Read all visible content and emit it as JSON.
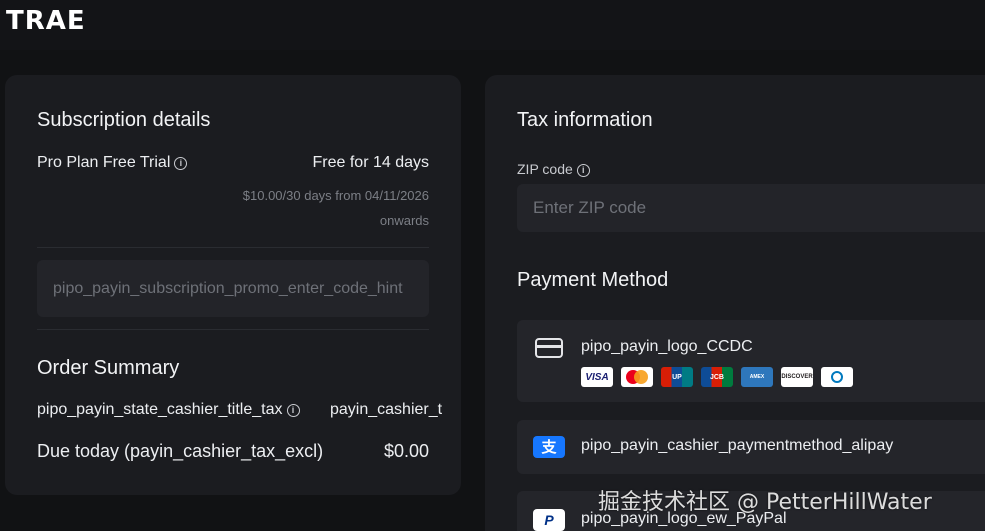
{
  "header": {
    "logo_text": "TRAE"
  },
  "subscription": {
    "title": "Subscription details",
    "plan_name": "Pro Plan Free Trial",
    "plan_price": "Free for 14 days",
    "renewal_line1": "$10.00/30 days from 04/11/2026",
    "renewal_line2": "onwards",
    "promo_placeholder": "pipo_payin_subscription_promo_enter_code_hint"
  },
  "order_summary": {
    "title": "Order Summary",
    "tax_row_label": "pipo_payin_state_cashier_title_tax",
    "tax_row_value": "payin_cashier_t",
    "due_label": "Due today (payin_cashier_tax_excl)",
    "due_value": "$0.00"
  },
  "tax_info": {
    "title": "Tax information",
    "zip_label": "ZIP code",
    "zip_placeholder": "Enter ZIP code"
  },
  "payment": {
    "title": "Payment Method",
    "methods": [
      {
        "label": "pipo_payin_logo_CCDC",
        "icon": "credit-card-icon"
      },
      {
        "label": "pipo_payin_cashier_paymentmethod_alipay",
        "icon": "alipay-icon"
      },
      {
        "label": "pipo_payin_logo_ew_PayPal",
        "icon": "paypal-icon"
      }
    ],
    "card_brands": [
      "VISA",
      "Mastercard",
      "UnionPay",
      "JCB",
      "American Express",
      "DISCOVER",
      "Diners Club"
    ]
  },
  "watermark": "掘金技术社区 @ PetterHillWater"
}
